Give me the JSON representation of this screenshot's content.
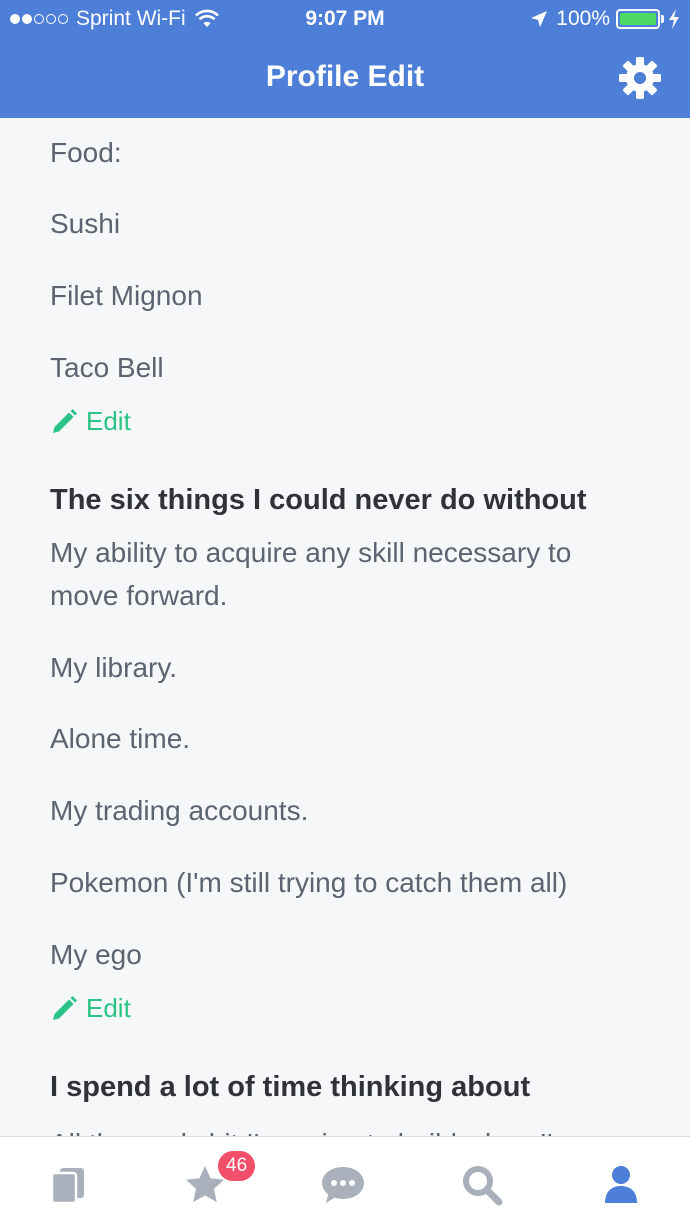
{
  "status_bar": {
    "carrier": "Sprint Wi-Fi",
    "time": "9:07 PM",
    "battery": "100%"
  },
  "header": {
    "title": "Profile Edit"
  },
  "sections": {
    "food": {
      "label": "Food:",
      "items": [
        "Sushi",
        "Filet Mignon",
        "Taco Bell"
      ],
      "edit_label": "Edit"
    },
    "six_things": {
      "heading": "The six things I could never do without",
      "items": [
        "My ability to acquire any skill necessary to move forward.",
        "My library.",
        "Alone time.",
        "My trading accounts.",
        "Pokemon (I'm still trying to catch them all)",
        "My ego"
      ],
      "edit_label": "Edit"
    },
    "thinking": {
      "heading": "I spend a lot of time thinking about",
      "partial_text": "All the cool shit I'm going to build when I'm"
    }
  },
  "tab_bar": {
    "tabs": [
      {
        "icon": "pages-icon"
      },
      {
        "icon": "star-icon",
        "badge": "46"
      },
      {
        "icon": "chat-icon"
      },
      {
        "icon": "search-icon"
      },
      {
        "icon": "profile-icon"
      }
    ],
    "active_color": "#4d7fd9",
    "inactive_color": "#a9b0bb"
  },
  "colors": {
    "header_bg": "#4d7fd9",
    "accent_green": "#2bc486",
    "badge_red": "#f2506a"
  }
}
